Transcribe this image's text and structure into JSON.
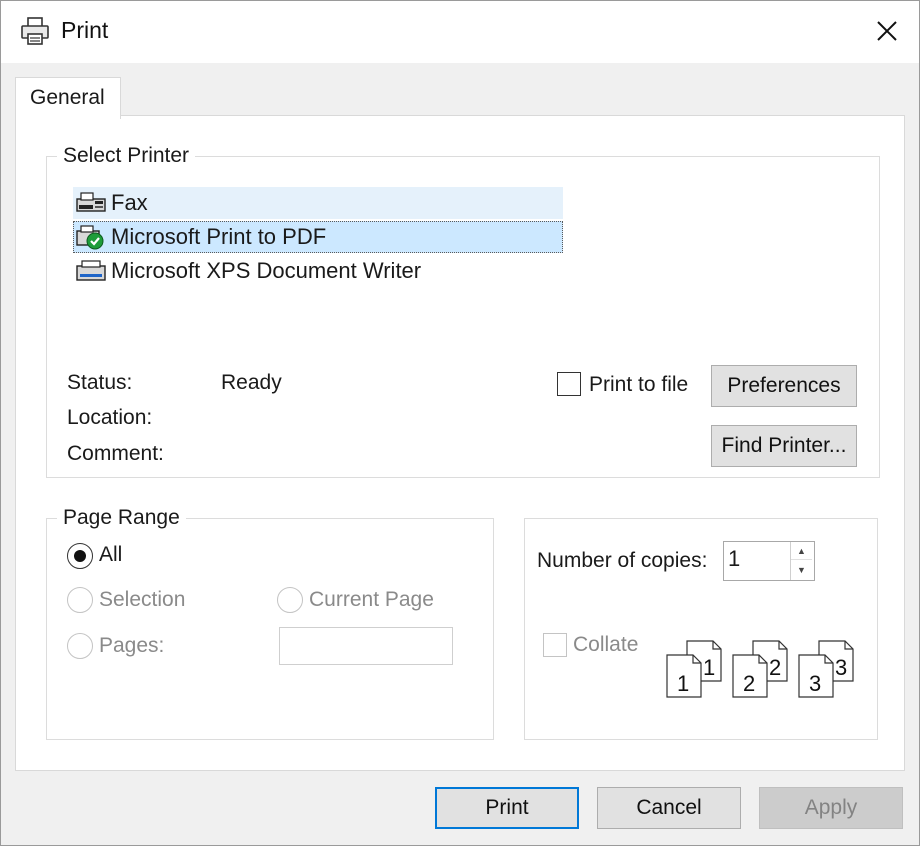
{
  "window": {
    "title": "Print"
  },
  "tabs": [
    {
      "label": "General"
    }
  ],
  "select_printer": {
    "title": "Select Printer",
    "printers": [
      {
        "name": "Fax",
        "icon": "fax-icon",
        "state": "hover"
      },
      {
        "name": "Microsoft Print to PDF",
        "icon": "pdf-printer-default-icon",
        "state": "selected"
      },
      {
        "name": "Microsoft XPS Document Writer",
        "icon": "xps-printer-icon",
        "state": "normal"
      }
    ],
    "status_label": "Status:",
    "status_value": "Ready",
    "location_label": "Location:",
    "location_value": "",
    "comment_label": "Comment:",
    "comment_value": "",
    "print_to_file_label": "Print to file",
    "print_to_file_checked": false,
    "preferences_label": "Preferences",
    "find_printer_label": "Find Printer..."
  },
  "page_range": {
    "title": "Page Range",
    "all_label": "All",
    "selection_label": "Selection",
    "current_page_label": "Current Page",
    "pages_label": "Pages:",
    "pages_value": "",
    "selected_option": "All"
  },
  "copies": {
    "number_label": "Number of copies:",
    "number_value": "1",
    "collate_label": "Collate",
    "collate_checked": false,
    "collate_pages": [
      "1",
      "1",
      "2",
      "2",
      "3",
      "3"
    ]
  },
  "footer": {
    "print_label": "Print",
    "cancel_label": "Cancel",
    "apply_label": "Apply"
  },
  "colors": {
    "selection_bg": "#cce8ff",
    "hover_bg": "#e5f1fb",
    "default_button_border": "#0078d7"
  }
}
